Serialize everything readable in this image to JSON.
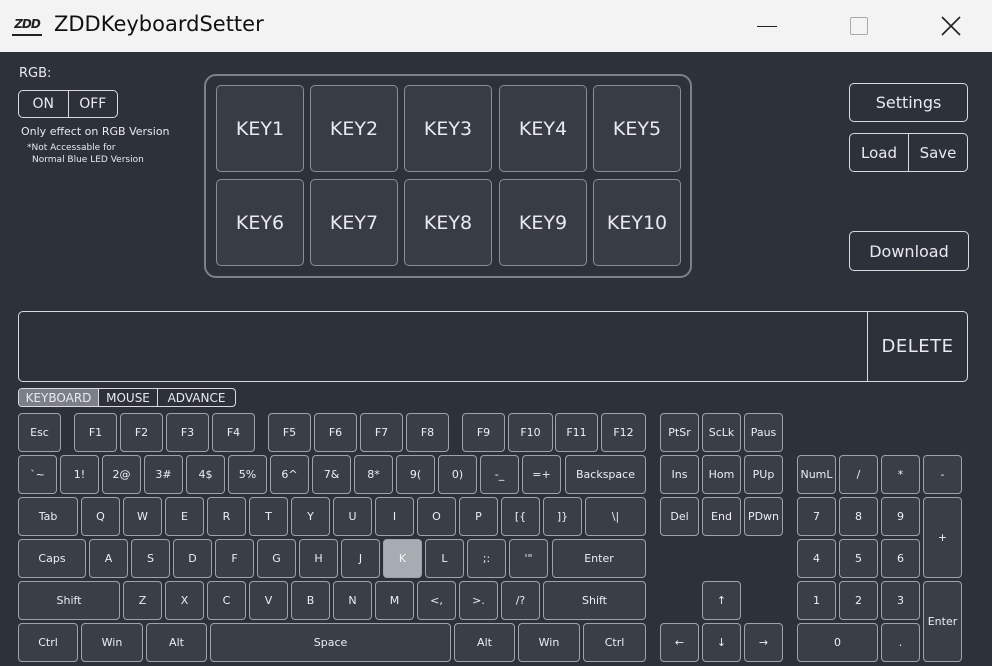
{
  "window": {
    "title": "ZDDKeyboardSetter",
    "logo_text": "ZDD"
  },
  "rgb": {
    "label": "RGB:",
    "on_label": "ON",
    "off_label": "OFF",
    "note_line1": "Only effect on RGB Version",
    "note_line2": "*Not Accessable for",
    "note_line3": "Normal Blue LED Version"
  },
  "keypad": {
    "keys": [
      "KEY1",
      "KEY2",
      "KEY3",
      "KEY4",
      "KEY5",
      "KEY6",
      "KEY7",
      "KEY8",
      "KEY9",
      "KEY10"
    ]
  },
  "actions": {
    "settings_label": "Settings",
    "load_label": "Load",
    "save_label": "Save",
    "download_label": "Download"
  },
  "macro": {
    "value": "",
    "delete_label": "DELETE"
  },
  "tabs": [
    {
      "label": "KEYBOARD",
      "active": true
    },
    {
      "label": "MOUSE",
      "active": false
    },
    {
      "label": "ADVANCE",
      "active": false
    }
  ],
  "keyboard": {
    "selected_key": "K",
    "rows": {
      "function": [
        "Esc",
        "F1",
        "F2",
        "F3",
        "F4",
        "F5",
        "F6",
        "F7",
        "F8",
        "F9",
        "F10",
        "F11",
        "F12"
      ],
      "number": [
        "`~",
        "1!",
        "2@",
        "3#",
        "4$",
        "5%",
        "6^",
        "7&",
        "8*",
        "9(",
        "0)",
        "-_",
        "=+",
        "Backspace"
      ],
      "top": [
        "Tab",
        "Q",
        "W",
        "E",
        "R",
        "T",
        "Y",
        "U",
        "I",
        "O",
        "P",
        "[{",
        "]}",
        "\\|"
      ],
      "home": [
        "Caps",
        "A",
        "S",
        "D",
        "F",
        "G",
        "H",
        "J",
        "K",
        "L",
        ";:",
        "'\"",
        "Enter"
      ],
      "shift": [
        "Shift",
        "Z",
        "X",
        "C",
        "V",
        "B",
        "N",
        "M",
        "<,",
        ">.",
        "/?",
        "Shift"
      ],
      "bottom": [
        "Ctrl",
        "Win",
        "Alt",
        "Space",
        "Alt",
        "Win",
        "Ctrl"
      ]
    },
    "nav": [
      "PtSr",
      "ScLk",
      "Paus",
      "Ins",
      "Hom",
      "PUp",
      "Del",
      "End",
      "PDwn",
      "↑",
      "←",
      "↓",
      "→"
    ],
    "numpad": [
      "NumL",
      "/",
      "*",
      "-",
      "7",
      "8",
      "9",
      "+",
      "4",
      "5",
      "6",
      "1",
      "2",
      "3",
      "Enter",
      "0",
      "."
    ]
  },
  "colors": {
    "background": "#2d323a",
    "titlebar": "#f3f3f3",
    "key_highlight": "#a7acb2"
  }
}
